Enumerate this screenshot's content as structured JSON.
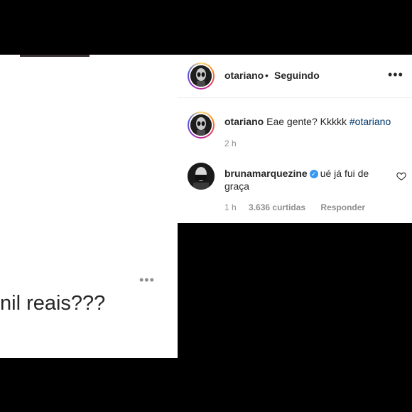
{
  "left_post": {
    "caption_fragment": "nil reais???"
  },
  "right_panel": {
    "top_clip_text": "...",
    "header": {
      "username": "otariano",
      "separator": "•",
      "follow_status": "Seguindo"
    },
    "comments": [
      {
        "username": "otariano",
        "text": "Eae gente? Kkkkk",
        "hashtag": "#otariano",
        "time": "2 h"
      },
      {
        "username": "brunamarquezine",
        "verified": true,
        "text": "ué já fui de graça",
        "time": "1 h",
        "likes": "3.636 curtidas",
        "reply_label": "Responder"
      }
    ]
  },
  "icons": {
    "more": "more-options-icon",
    "heart": "heart-icon",
    "verified": "verified-badge-icon"
  },
  "colors": {
    "link_hashtag": "#00376b",
    "verified": "#3897f0",
    "muted_text": "#8e8e8e"
  }
}
